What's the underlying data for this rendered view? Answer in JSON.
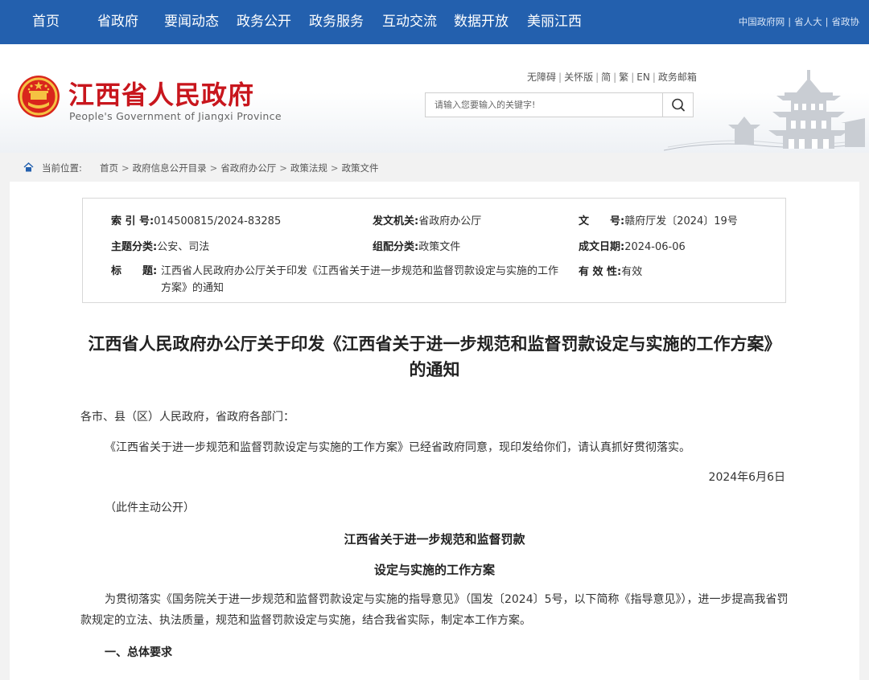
{
  "nav": {
    "items": [
      "首页",
      "省政府",
      "要闻动态",
      "政务公开",
      "政务服务",
      "互动交流",
      "数据开放",
      "美丽江西"
    ],
    "right_links": [
      "中国政府网",
      "省人大",
      "省政协"
    ],
    "bg_color": "#2360ae"
  },
  "header": {
    "title": "江西省人民政府",
    "subtitle": "People's Government of Jiangxi Province",
    "title_color": "#c8161d",
    "tools": [
      "无障碍",
      "关怀版",
      "简",
      "繁",
      "EN",
      "政务邮箱"
    ],
    "search": {
      "placeholder": "请输入您要输入的关键字!",
      "value": ""
    }
  },
  "breadcrumb": {
    "label": "当前位置:",
    "items": [
      "首页",
      "政府信息公开目录",
      "省政府办公厅",
      "政策法规",
      "政策文件"
    ]
  },
  "meta": {
    "index_label": "索 引 号:",
    "index_value": "014500815/2024-83285",
    "issuer_label": "发文机关:",
    "issuer_value": "省政府办公厅",
    "docno_label": "文　　号:",
    "docno_value": "赣府厅发〔2024〕19号",
    "topic_label": "主题分类:",
    "topic_value": "公安、司法",
    "category_label": "组配分类:",
    "category_value": "政策文件",
    "date_label": "成文日期:",
    "date_value": "2024-06-06",
    "title_label": "标　　题:",
    "title_value": "江西省人民政府办公厅关于印发《江西省关于进一步规范和监督罚款设定与实施的工作方案》的通知",
    "validity_label": "有 效 性:",
    "validity_value": "有效"
  },
  "document": {
    "title": "江西省人民政府办公厅关于印发《江西省关于进一步规范和监督罚款设定与实施的工作方案》的通知",
    "salutation": "各市、县（区）人民政府，省政府各部门：",
    "body1": "《江西省关于进一步规范和监督罚款设定与实施的工作方案》已经省政府同意，现印发给你们，请认真抓好贯彻落实。",
    "date": "2024年6月6日",
    "note": "（此件主动公开）",
    "plan_title_1": "江西省关于进一步规范和监督罚款",
    "plan_title_2": "设定与实施的工作方案",
    "body2": "为贯彻落实《国务院关于进一步规范和监督罚款设定与实施的指导意见》（国发〔2024〕5号，以下简称《指导意见》），进一步提高我省罚款规定的立法、执法质量，规范和监督罚款设定与实施，结合我省实际，制定本工作方案。",
    "section1": "一、总体要求"
  },
  "icons": [
    "national-emblem-icon",
    "search-icon",
    "home-icon",
    "pagoda-illustration"
  ]
}
